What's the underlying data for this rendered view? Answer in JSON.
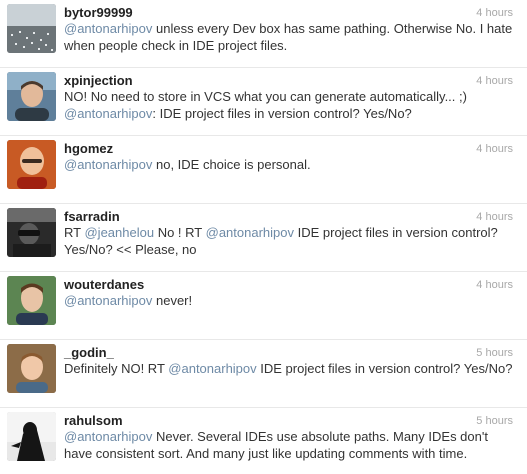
{
  "tweets": [
    {
      "username": "bytor99999",
      "time": "4 hours",
      "avatar_icon": "bytor-avatar",
      "text": {
        "mention": "@antonarhipov",
        "rest": " unless every Dev box has same pathing. Otherwise No. I hate when people check in IDE project files."
      }
    },
    {
      "username": "xpinjection",
      "time": "4 hours",
      "avatar_icon": "xpinjection-avatar",
      "text": {
        "p1": "NO! No need to store in VCS what you can generate automatically... ;)",
        "mention": "@antonarhipov",
        "p2": ": IDE project files in version control? Yes/No?"
      }
    },
    {
      "username": "hgomez",
      "time": "4 hours",
      "avatar_icon": "hgomez-avatar",
      "text": {
        "mention": "@antonarhipov",
        "rest": " no, IDE choice is personal."
      }
    },
    {
      "username": "fsarradin",
      "time": "4 hours",
      "avatar_icon": "fsarradin-avatar",
      "text": {
        "p1": "RT ",
        "mention1": "@jeanhelou",
        "p2": " No ! RT ",
        "mention2": "@antonarhipov",
        "p3": " IDE project files in version control? Yes/No? << Please, no"
      }
    },
    {
      "username": "wouterdanes",
      "time": "4 hours",
      "avatar_icon": "wouterdanes-avatar",
      "text": {
        "mention": "@antonarhipov",
        "rest": " never!"
      }
    },
    {
      "username": "_godin_",
      "time": "5 hours",
      "avatar_icon": "godin-avatar",
      "text": {
        "p1": "Definitely NO! RT ",
        "mention": "@antonarhipov",
        "p2": " IDE project files in version control? Yes/No?"
      }
    },
    {
      "username": "rahulsom",
      "time": "5 hours",
      "avatar_icon": "rahulsom-avatar",
      "text": {
        "mention": "@antonarhipov",
        "rest": " Never. Several IDEs use absolute paths. Many IDEs don't have consistent sort. And many just like updating comments with time."
      }
    }
  ],
  "colors": {
    "username": "#222222",
    "text": "#333333",
    "mention": "#6e8aa6",
    "time": "#a8a8a8",
    "divider": "#e8e8e8"
  }
}
